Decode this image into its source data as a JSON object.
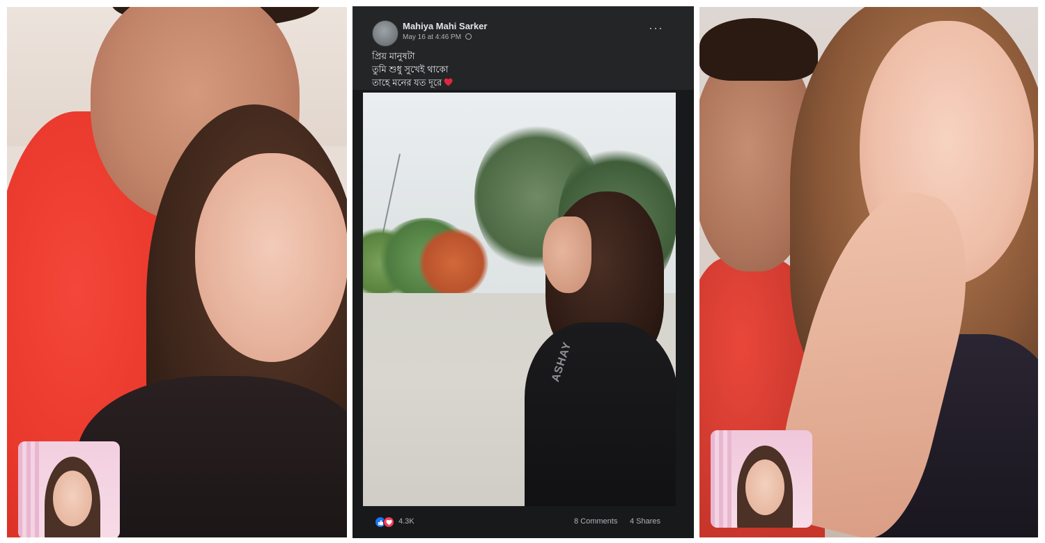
{
  "post": {
    "author_name": "Mahiya Mahi Sarker",
    "timestamp": "May 16 at 4:46 PM",
    "privacy_icon": "globe-icon",
    "more_options_icon": "ellipsis-icon",
    "text_lines": [
      "প্রিয় মানুষটা",
      "তুমি শুধু সুখেই থাকো",
      "তাহে মনের যত দূরে"
    ],
    "text_emoji": "heart-emoji",
    "reactions": {
      "icons": [
        "like-icon",
        "love-icon"
      ],
      "count": "4.3K"
    },
    "comments_label": "8 Comments",
    "shares_label": "4 Shares",
    "shirt_print": "ASHAY",
    "colors": {
      "background": "#18191a",
      "header": "#242526",
      "text_primary": "#e4e6eb",
      "text_secondary": "#b0b3b8",
      "like": "#1877f2",
      "love": "#f33e58"
    }
  },
  "left_panel": {
    "type": "video-call-screenshot",
    "has_pip_preview": true
  },
  "right_panel": {
    "type": "video-call-screenshot",
    "has_pip_preview": true
  }
}
